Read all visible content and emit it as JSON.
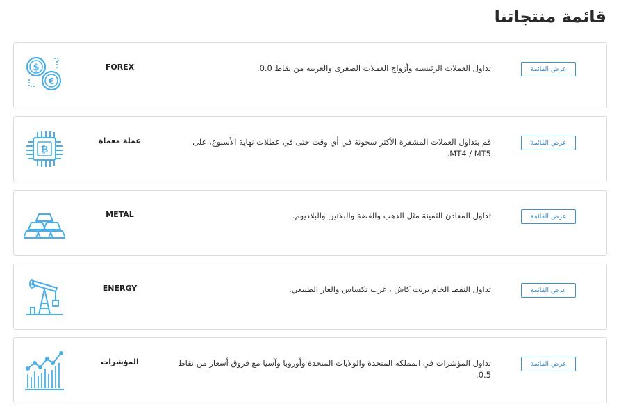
{
  "page": {
    "title": "قائمة منتجاتنا"
  },
  "accent_color": "#3f8fc9",
  "icon_color": "#4aaee8",
  "products": [
    {
      "icon": "currency-coins-icon",
      "name": "FOREX",
      "description": "تداول العملات الرئيسية وأزواج العملات الصغرى والغريبة من نقاط 0.0.",
      "button_label": "عرض القائمة"
    },
    {
      "icon": "bitcoin-chip-icon",
      "name": "عملة معماة",
      "description": "قم بتداول العملات المشفرة الأكثر سخونة في أي وقت حتى في عطلات نهاية الأسبوع، على MT4 / MT5.",
      "button_label": "عرض القائمة"
    },
    {
      "icon": "gold-bars-icon",
      "name": "METAL",
      "description": "تداول المعادن الثمينة مثل الذهب والفضة والبلاتين والبلاديوم.",
      "button_label": "عرض القائمة"
    },
    {
      "icon": "oil-pump-icon",
      "name": "ENERGY",
      "description": "تداول النفط الخام برنت كاش ، غرب تكساس والغاز الطبيعي.",
      "button_label": "عرض القائمة"
    },
    {
      "icon": "bar-chart-trend-icon",
      "name": "المؤشرات",
      "description": "تداول المؤشرات في المملكة المتحدة والولايات المتحدة وأوروبا وآسيا مع فروق أسعار من نقاط 0.5.",
      "button_label": "عرض القائمة"
    }
  ]
}
